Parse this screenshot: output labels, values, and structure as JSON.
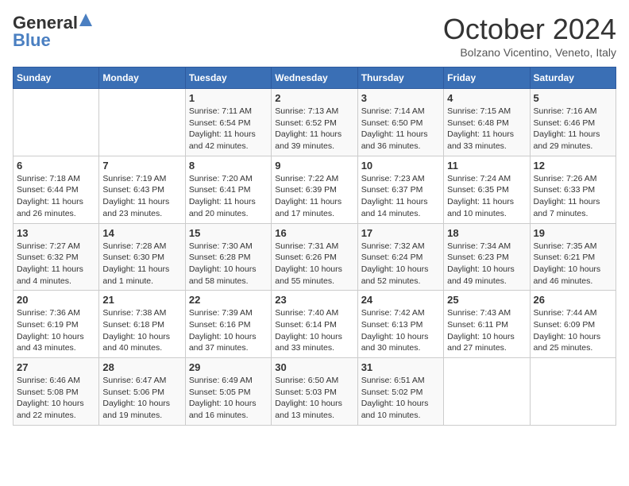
{
  "header": {
    "logo_general": "General",
    "logo_blue": "Blue",
    "month_title": "October 2024",
    "location": "Bolzano Vicentino, Veneto, Italy"
  },
  "days_of_week": [
    "Sunday",
    "Monday",
    "Tuesday",
    "Wednesday",
    "Thursday",
    "Friday",
    "Saturday"
  ],
  "weeks": [
    [
      {
        "day": "",
        "info": ""
      },
      {
        "day": "",
        "info": ""
      },
      {
        "day": "1",
        "info": "Sunrise: 7:11 AM\nSunset: 6:54 PM\nDaylight: 11 hours and 42 minutes."
      },
      {
        "day": "2",
        "info": "Sunrise: 7:13 AM\nSunset: 6:52 PM\nDaylight: 11 hours and 39 minutes."
      },
      {
        "day": "3",
        "info": "Sunrise: 7:14 AM\nSunset: 6:50 PM\nDaylight: 11 hours and 36 minutes."
      },
      {
        "day": "4",
        "info": "Sunrise: 7:15 AM\nSunset: 6:48 PM\nDaylight: 11 hours and 33 minutes."
      },
      {
        "day": "5",
        "info": "Sunrise: 7:16 AM\nSunset: 6:46 PM\nDaylight: 11 hours and 29 minutes."
      }
    ],
    [
      {
        "day": "6",
        "info": "Sunrise: 7:18 AM\nSunset: 6:44 PM\nDaylight: 11 hours and 26 minutes."
      },
      {
        "day": "7",
        "info": "Sunrise: 7:19 AM\nSunset: 6:43 PM\nDaylight: 11 hours and 23 minutes."
      },
      {
        "day": "8",
        "info": "Sunrise: 7:20 AM\nSunset: 6:41 PM\nDaylight: 11 hours and 20 minutes."
      },
      {
        "day": "9",
        "info": "Sunrise: 7:22 AM\nSunset: 6:39 PM\nDaylight: 11 hours and 17 minutes."
      },
      {
        "day": "10",
        "info": "Sunrise: 7:23 AM\nSunset: 6:37 PM\nDaylight: 11 hours and 14 minutes."
      },
      {
        "day": "11",
        "info": "Sunrise: 7:24 AM\nSunset: 6:35 PM\nDaylight: 11 hours and 10 minutes."
      },
      {
        "day": "12",
        "info": "Sunrise: 7:26 AM\nSunset: 6:33 PM\nDaylight: 11 hours and 7 minutes."
      }
    ],
    [
      {
        "day": "13",
        "info": "Sunrise: 7:27 AM\nSunset: 6:32 PM\nDaylight: 11 hours and 4 minutes."
      },
      {
        "day": "14",
        "info": "Sunrise: 7:28 AM\nSunset: 6:30 PM\nDaylight: 11 hours and 1 minute."
      },
      {
        "day": "15",
        "info": "Sunrise: 7:30 AM\nSunset: 6:28 PM\nDaylight: 10 hours and 58 minutes."
      },
      {
        "day": "16",
        "info": "Sunrise: 7:31 AM\nSunset: 6:26 PM\nDaylight: 10 hours and 55 minutes."
      },
      {
        "day": "17",
        "info": "Sunrise: 7:32 AM\nSunset: 6:24 PM\nDaylight: 10 hours and 52 minutes."
      },
      {
        "day": "18",
        "info": "Sunrise: 7:34 AM\nSunset: 6:23 PM\nDaylight: 10 hours and 49 minutes."
      },
      {
        "day": "19",
        "info": "Sunrise: 7:35 AM\nSunset: 6:21 PM\nDaylight: 10 hours and 46 minutes."
      }
    ],
    [
      {
        "day": "20",
        "info": "Sunrise: 7:36 AM\nSunset: 6:19 PM\nDaylight: 10 hours and 43 minutes."
      },
      {
        "day": "21",
        "info": "Sunrise: 7:38 AM\nSunset: 6:18 PM\nDaylight: 10 hours and 40 minutes."
      },
      {
        "day": "22",
        "info": "Sunrise: 7:39 AM\nSunset: 6:16 PM\nDaylight: 10 hours and 37 minutes."
      },
      {
        "day": "23",
        "info": "Sunrise: 7:40 AM\nSunset: 6:14 PM\nDaylight: 10 hours and 33 minutes."
      },
      {
        "day": "24",
        "info": "Sunrise: 7:42 AM\nSunset: 6:13 PM\nDaylight: 10 hours and 30 minutes."
      },
      {
        "day": "25",
        "info": "Sunrise: 7:43 AM\nSunset: 6:11 PM\nDaylight: 10 hours and 27 minutes."
      },
      {
        "day": "26",
        "info": "Sunrise: 7:44 AM\nSunset: 6:09 PM\nDaylight: 10 hours and 25 minutes."
      }
    ],
    [
      {
        "day": "27",
        "info": "Sunrise: 6:46 AM\nSunset: 5:08 PM\nDaylight: 10 hours and 22 minutes."
      },
      {
        "day": "28",
        "info": "Sunrise: 6:47 AM\nSunset: 5:06 PM\nDaylight: 10 hours and 19 minutes."
      },
      {
        "day": "29",
        "info": "Sunrise: 6:49 AM\nSunset: 5:05 PM\nDaylight: 10 hours and 16 minutes."
      },
      {
        "day": "30",
        "info": "Sunrise: 6:50 AM\nSunset: 5:03 PM\nDaylight: 10 hours and 13 minutes."
      },
      {
        "day": "31",
        "info": "Sunrise: 6:51 AM\nSunset: 5:02 PM\nDaylight: 10 hours and 10 minutes."
      },
      {
        "day": "",
        "info": ""
      },
      {
        "day": "",
        "info": ""
      }
    ]
  ]
}
